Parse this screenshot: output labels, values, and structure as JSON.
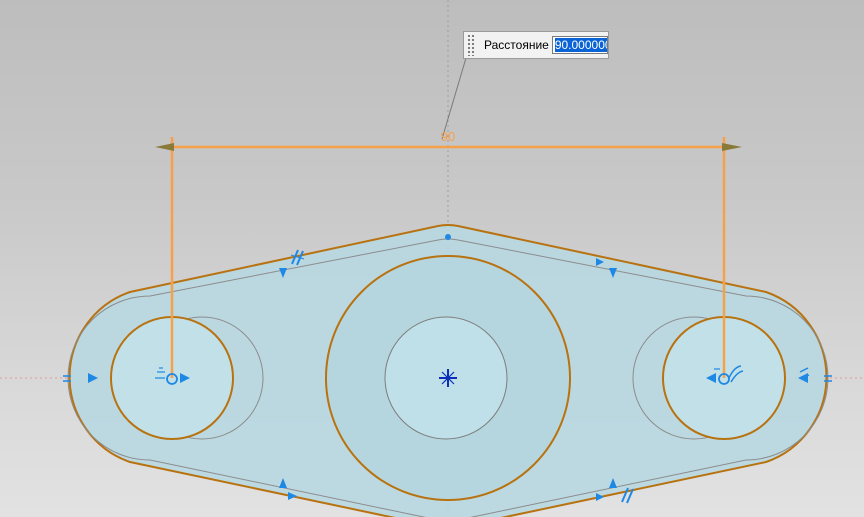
{
  "dimension_editor": {
    "label": "Расстояние",
    "value": "90.000000"
  },
  "dimension": {
    "text": "90"
  },
  "colors": {
    "dimension_orange": "#f7a04a",
    "sketch_curve": "#b8720f",
    "constraint_blue": "#1e88e5",
    "body_fill": "#b9d8e2"
  },
  "icons": [
    "grip-icon",
    "center-point-icon",
    "parallel-constraint-icon",
    "tangent-constraint-icon",
    "equal-constraint-icon"
  ]
}
